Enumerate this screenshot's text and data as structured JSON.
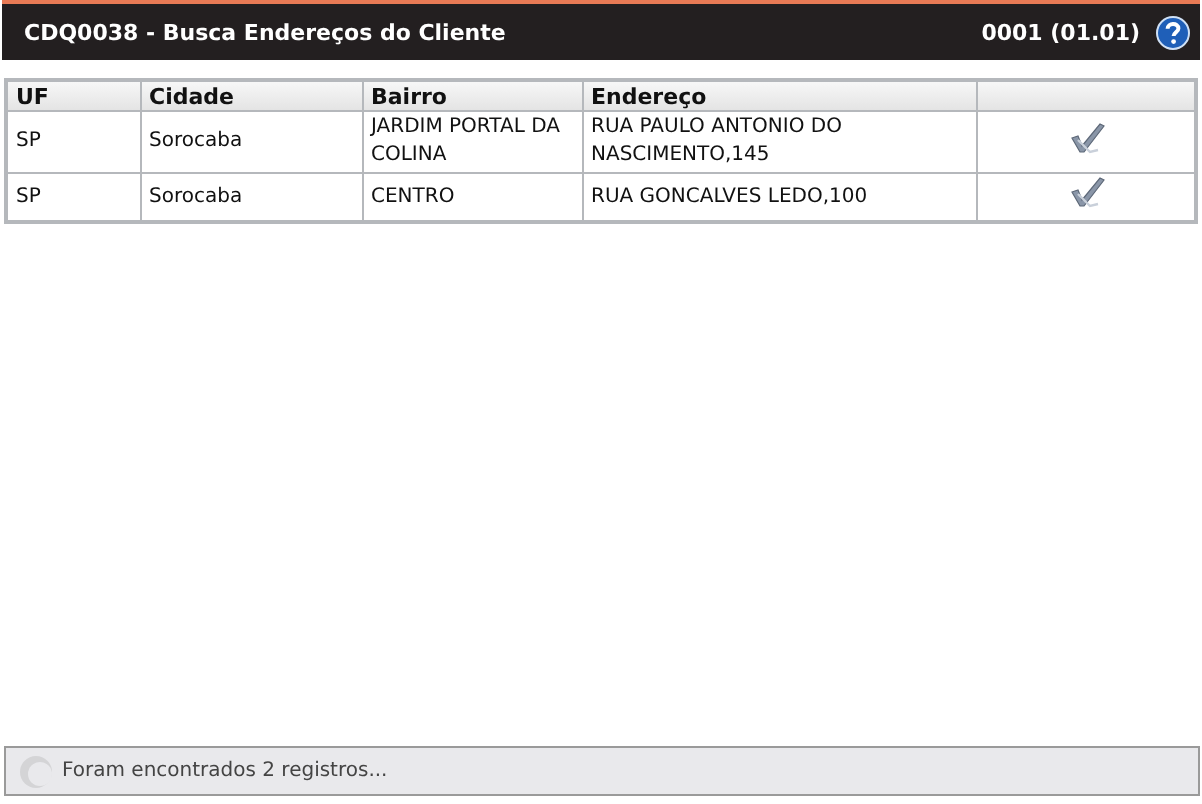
{
  "header": {
    "title": "CDQ0038 - Busca Endereços do Cliente",
    "version": "0001 (01.01)"
  },
  "table": {
    "columns": [
      "UF",
      "Cidade",
      "Bairro",
      "Endereço",
      ""
    ],
    "rows": [
      {
        "cells": [
          "SP",
          "Sorocaba",
          "JARDIM PORTAL DA COLINA",
          "RUA PAULO ANTONIO DO NASCIMENTO,145"
        ]
      },
      {
        "cells": [
          "SP",
          "Sorocaba",
          "CENTRO",
          "RUA GONCALVES LEDO,100"
        ]
      }
    ]
  },
  "status_bar": {
    "text": "Foram encontrados 2 registros..."
  }
}
